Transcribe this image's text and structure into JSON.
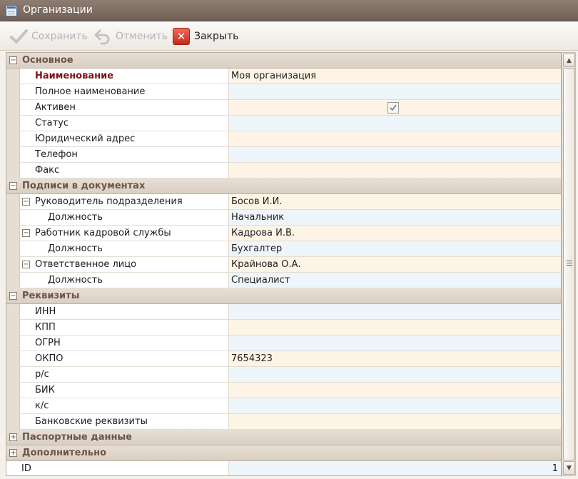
{
  "window": {
    "title": "Организации",
    "icon": "table-window-icon"
  },
  "toolbar": {
    "save_label": "Сохранить",
    "cancel_label": "Отменить",
    "close_label": "Закрыть",
    "save_icon": "checkmark-icon",
    "cancel_icon": "undo-icon",
    "close_icon": "close-icon"
  },
  "colors": {
    "category_text": "#6d5446",
    "required_label": "#7a1414",
    "value_peach": "#fdf4e6",
    "value_blue": "#eef5fb"
  },
  "grid": {
    "cat_main": "Основное",
    "name": "Наименование",
    "name_value": "Моя организация",
    "full_name": "Полное наименование",
    "full_name_value": "",
    "active": "Активен",
    "active_checked": true,
    "status": "Статус",
    "status_value": "",
    "legal_address": "Юридический адрес",
    "legal_address_value": "",
    "phone": "Телефон",
    "phone_value": "",
    "fax": "Факс",
    "fax_value": "",
    "cat_signatures": "Подписи в документах",
    "head": "Руководитель подразделения",
    "head_value": "Босов И.И.",
    "head_position": "Должность",
    "head_position_value": "Начальник",
    "hr": "Работник кадровой службы",
    "hr_value": "Кадрова И.В.",
    "hr_position": "Должность",
    "hr_position_value": "Бухгалтер",
    "responsible": "Ответственное лицо",
    "responsible_value": "Крайнова О.А.",
    "responsible_position": "Должность",
    "responsible_position_value": "Специалист",
    "cat_requisites": "Реквизиты",
    "inn": "ИНН",
    "inn_value": "",
    "kpp": "КПП",
    "kpp_value": "",
    "ogrn": "ОГРН",
    "ogrn_value": "",
    "okpo": "ОКПО",
    "okpo_value": "7654323",
    "account": "р/с",
    "account_value": "",
    "bik": "БИК",
    "bik_value": "",
    "corr_account": "к/с",
    "corr_account_value": "",
    "bank_details": "Банковские реквизиты",
    "bank_details_value": "",
    "cat_passport": "Паспортные данные",
    "cat_additional": "Дополнительно",
    "id": "ID",
    "id_value": "1"
  }
}
